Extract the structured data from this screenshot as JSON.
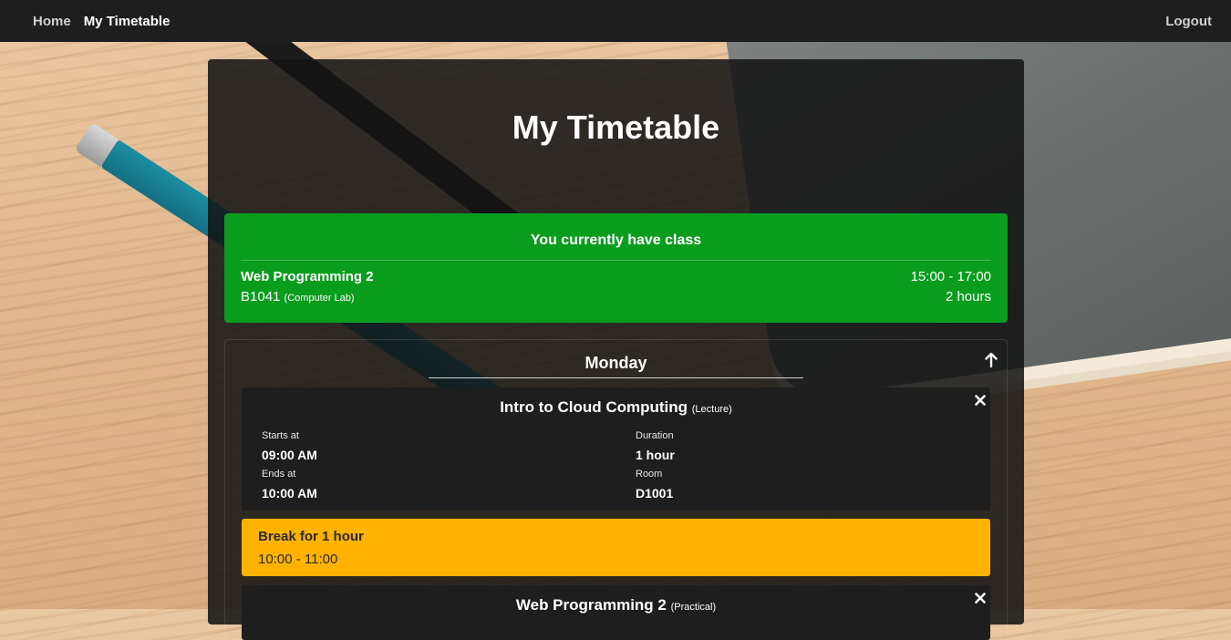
{
  "nav": {
    "home": "Home",
    "my_timetable": "My Timetable",
    "logout": "Logout"
  },
  "page": {
    "title": "My Timetable"
  },
  "current": {
    "heading": "You currently have class",
    "course": "Web Programming 2",
    "time": "15:00 - 17:00",
    "room": "B1041",
    "room_type": "(Computer Lab)",
    "duration": "2 hours",
    "color": "#0a9d1d"
  },
  "day": {
    "name": "Monday",
    "collapse_icon": "arrow-up-icon",
    "classes": [
      {
        "title": "Intro to Cloud Computing",
        "type": "(Lecture)",
        "starts_label": "Starts at",
        "starts": "09:00 AM",
        "ends_label": "Ends at",
        "ends": "10:00 AM",
        "duration_label": "Duration",
        "duration": "1 hour",
        "room_label": "Room",
        "room": "D1001"
      },
      {
        "title": "Web Programming 2",
        "type": "(Practical)"
      }
    ],
    "break": {
      "title": "Break for 1 hour",
      "time": "10:00 - 11:00",
      "color": "#ffb300"
    }
  }
}
